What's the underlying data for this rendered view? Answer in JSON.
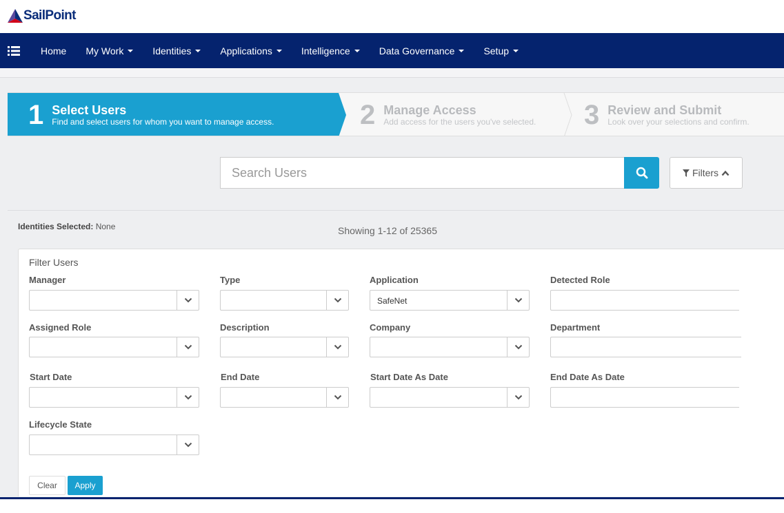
{
  "brand": {
    "name": "SailPoint",
    "color": "#0a2d7a",
    "accent": "#1aa0d0",
    "nav_bg": "#05236e"
  },
  "nav": {
    "menu_icon": "list-icon",
    "items": [
      {
        "label": "Home"
      },
      {
        "label": "My Work"
      },
      {
        "label": "Identities"
      },
      {
        "label": "Applications"
      },
      {
        "label": "Intelligence"
      },
      {
        "label": "Data Governance"
      },
      {
        "label": "Setup"
      }
    ]
  },
  "wizard": {
    "steps": [
      {
        "number": "1",
        "title": "Select Users",
        "description": "Find and select users for whom you want to manage access."
      },
      {
        "number": "2",
        "title": "Manage Access",
        "description": "Add access for the users you've selected."
      },
      {
        "number": "3",
        "title": "Review and Submit",
        "description": "Look over your selections and confirm."
      }
    ]
  },
  "search": {
    "placeholder": "Search Users",
    "button_icon": "search-icon"
  },
  "filters_button": {
    "label": "Filters"
  },
  "identities_selected": {
    "label": "Identities Selected:",
    "value": "None"
  },
  "showing": "Showing 1-12 of 25365",
  "filter_panel": {
    "title": "Filter Users",
    "fields": {
      "manager": {
        "label": "Manager",
        "value": ""
      },
      "type": {
        "label": "Type",
        "value": ""
      },
      "application": {
        "label": "Application",
        "value": "SafeNet"
      },
      "detected_role": {
        "label": "Detected Role",
        "value": ""
      },
      "assigned_role": {
        "label": "Assigned Role",
        "value": ""
      },
      "description": {
        "label": "Description",
        "value": ""
      },
      "company": {
        "label": "Company",
        "value": ""
      },
      "department": {
        "label": "Department",
        "value": ""
      },
      "start_date": {
        "label": "Start Date",
        "value": ""
      },
      "end_date": {
        "label": "End Date",
        "value": ""
      },
      "start_date_as_date": {
        "label": "Start Date As Date",
        "value": ""
      },
      "end_date_as_date": {
        "label": "End Date As Date",
        "value": ""
      },
      "lifecycle_state": {
        "label": "Lifecycle State",
        "value": ""
      }
    },
    "clear_label": "Clear",
    "apply_label": "Apply"
  }
}
